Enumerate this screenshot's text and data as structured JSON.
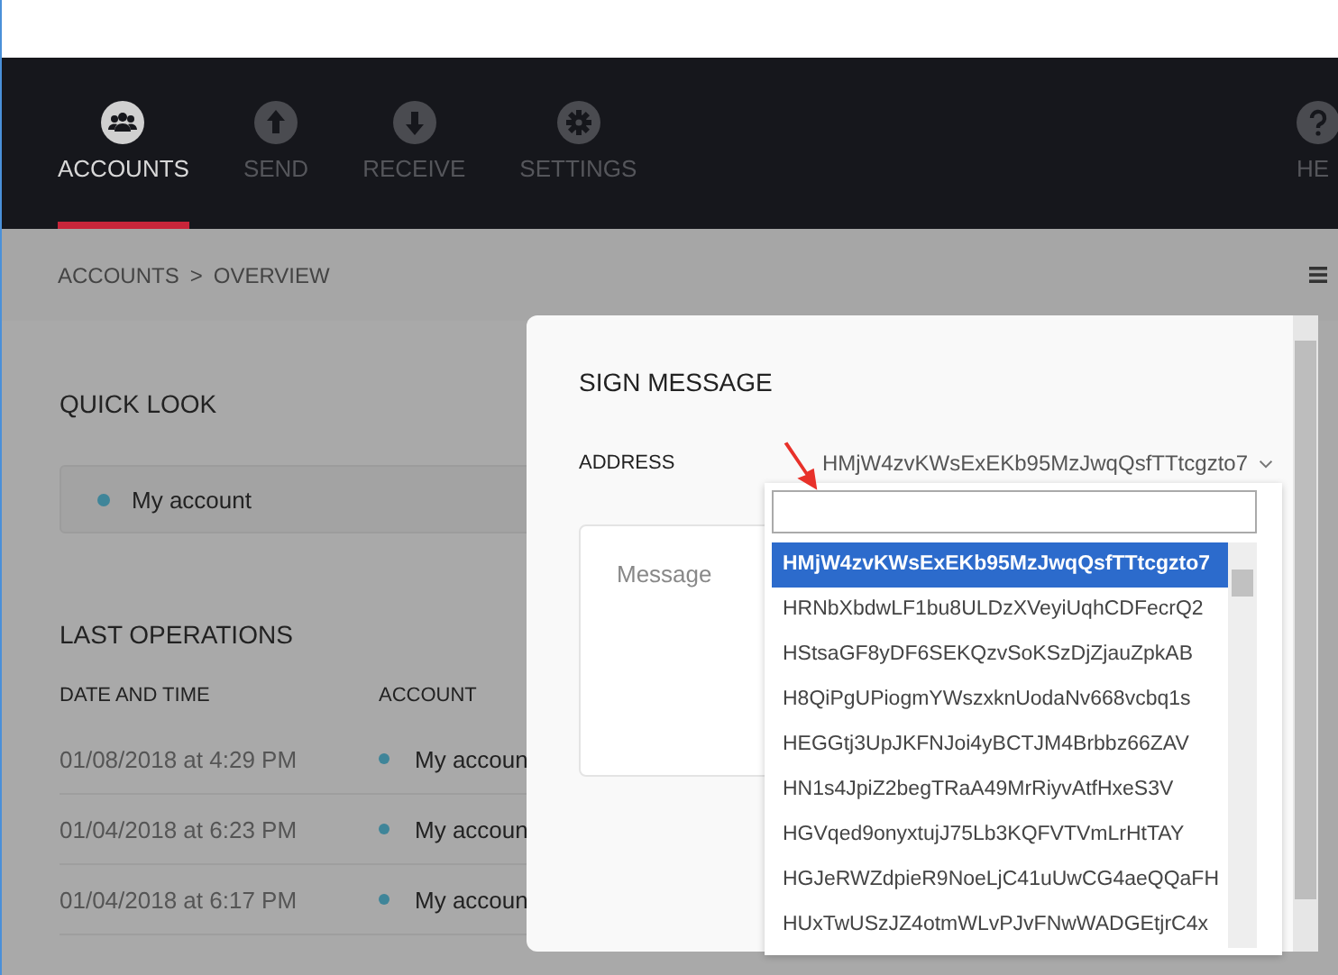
{
  "nav": {
    "items": [
      {
        "label": "ACCOUNTS",
        "kind": "accounts",
        "selected": true
      },
      {
        "label": "SEND",
        "kind": "send",
        "selected": false
      },
      {
        "label": "RECEIVE",
        "kind": "receive",
        "selected": false
      },
      {
        "label": "SETTINGS",
        "kind": "settings",
        "selected": false
      }
    ],
    "help": {
      "label": "HE"
    }
  },
  "breadcrumb": {
    "items": [
      "ACCOUNTS",
      "OVERVIEW"
    ],
    "separator": ">"
  },
  "quick_look": {
    "title": "QUICK LOOK",
    "account": {
      "name": "My account",
      "color": "#3f8599"
    }
  },
  "last_operations": {
    "title": "LAST OPERATIONS",
    "columns": [
      "DATE AND TIME",
      "ACCOUNT"
    ],
    "rows": [
      {
        "date": "01/08/2018 at 4:29 PM",
        "account": "My accoun",
        "color": "#3f8599"
      },
      {
        "date": "01/04/2018 at 6:23 PM",
        "account": "My accoun",
        "color": "#3f8599"
      },
      {
        "date": "01/04/2018 at 6:17 PM",
        "account": "My accoun",
        "color": "#3f8599"
      }
    ]
  },
  "modal": {
    "title": "SIGN MESSAGE",
    "address_label": "ADDRESS",
    "address_value": "HMjW4zvKWsExEKb95MzJwqQsfTTtcgzto7",
    "message_placeholder": "Message",
    "dropdown": {
      "options": [
        {
          "label": "HMjW4zvKWsExEKb95MzJwqQsfTTtcgzto7",
          "selected": true
        },
        {
          "label": "HRNbXbdwLF1bu8ULDzXVeyiUqhCDFecrQ2",
          "selected": false
        },
        {
          "label": "HStsaGF8yDF6SEKQzvSoKSzDjZjauZpkAB",
          "selected": false
        },
        {
          "label": "H8QiPgUPiogmYWszxknUodaNv668vcbq1s",
          "selected": false
        },
        {
          "label": "HEGGtj3UpJKFNJoi4yBCTJM4Brbbz66ZAV",
          "selected": false
        },
        {
          "label": "HN1s4JpiZ2begTRaA49MrRiyvAtfHxeS3V",
          "selected": false
        },
        {
          "label": "HGVqed9onyxtujJ75Lb3KQFVTVmLrHtTAY",
          "selected": false
        },
        {
          "label": "HGJeRWZdpieR9NoeLjC41uUwCG4aeQQaFH",
          "selected": false
        },
        {
          "label": "HUxTwUSzJZ4otmWLvPJvFNwWADGEtjrC4x",
          "selected": false
        }
      ]
    }
  }
}
